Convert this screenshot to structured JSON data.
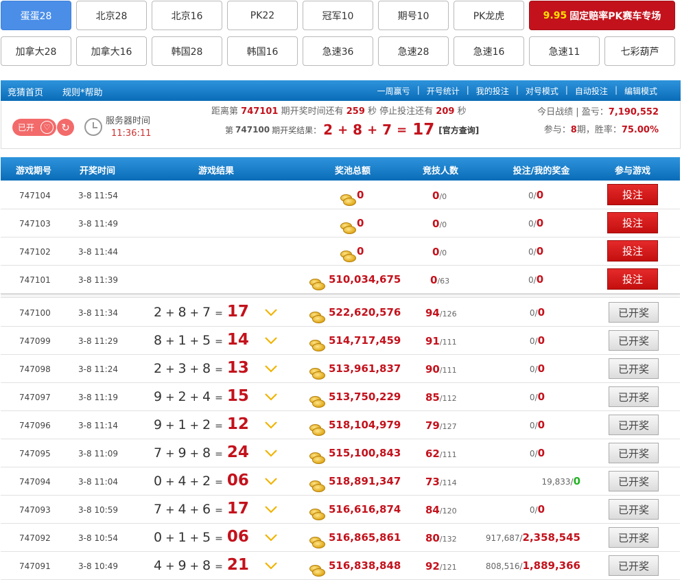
{
  "tabs_row1": [
    "蛋蛋28",
    "北京28",
    "北京16",
    "PK22",
    "冠军10",
    "期号10",
    "PK龙虎"
  ],
  "promo": {
    "highlight": "9.95",
    "label": "固定赔率PK赛车专场"
  },
  "tabs_row2": [
    "加拿大28",
    "加拿大16",
    "韩国28",
    "韩国16",
    "急速36",
    "急速28",
    "急速16",
    "急速11",
    "七彩葫芦"
  ],
  "nav": {
    "home": "竞猜首页",
    "rules": "规则*帮助",
    "links": [
      "一周赢亏",
      "开号统计",
      "我的投注",
      "对号模式",
      "自动投注",
      "编辑模式"
    ],
    "separator": "|"
  },
  "info": {
    "status": "已开",
    "server_time_label": "服务器时间",
    "server_time": "11:36:11",
    "countdown_prefix": "距离第",
    "countdown_period": "747101",
    "countdown_mid": "期开奖时间还有",
    "countdown_seconds": "259",
    "countdown_sec_unit": "秒 停止投注还有",
    "stop_seconds": "209",
    "stop_unit": "秒",
    "last_prefix": "第",
    "last_period": "747100",
    "last_mid": "期开奖结果：",
    "last_a": "2",
    "last_b": "8",
    "last_c": "7",
    "last_sum": "17",
    "official": "[官方查询]",
    "today_label": "今日战绩 | 盈亏：",
    "today_value": "7,190,552",
    "join_label": "参与：",
    "join_value": "8",
    "join_unit": "期，胜率：",
    "win_rate": "75.00%"
  },
  "table_headers": [
    "游戏期号",
    "开奖时间",
    "游戏结果",
    "奖池总额",
    "竞技人数",
    "投注/我的奖金",
    "参与游戏"
  ],
  "colors": {
    "accent": "#0a6cb8",
    "red": "#c3121c",
    "green": "#23b223"
  },
  "open_rows": [
    {
      "period": "747104",
      "time": "3-8 11:54",
      "pool": "0",
      "players": "0",
      "total": "/0",
      "bet": "0/",
      "win": "0",
      "action": "投注"
    },
    {
      "period": "747103",
      "time": "3-8 11:49",
      "pool": "0",
      "players": "0",
      "total": "/0",
      "bet": "0/",
      "win": "0",
      "action": "投注"
    },
    {
      "period": "747102",
      "time": "3-8 11:44",
      "pool": "0",
      "players": "0",
      "total": "/0",
      "bet": "0/",
      "win": "0",
      "action": "投注"
    },
    {
      "period": "747101",
      "time": "3-8 11:39",
      "pool": "510,034,675",
      "players": "0",
      "total": "/63",
      "bet": "0/",
      "win": "0",
      "action": "投注"
    }
  ],
  "closed_rows": [
    {
      "period": "747100",
      "time": "3-8 11:34",
      "a": "2",
      "b": "8",
      "c": "7",
      "sum": "17",
      "pool": "522,620,576",
      "players": "94",
      "total": "/126",
      "bet": "0/",
      "win": "0",
      "win_green": false,
      "action": "已开奖"
    },
    {
      "period": "747099",
      "time": "3-8 11:29",
      "a": "8",
      "b": "1",
      "c": "5",
      "sum": "14",
      "pool": "514,717,459",
      "players": "91",
      "total": "/111",
      "bet": "0/",
      "win": "0",
      "win_green": false,
      "action": "已开奖"
    },
    {
      "period": "747098",
      "time": "3-8 11:24",
      "a": "2",
      "b": "3",
      "c": "8",
      "sum": "13",
      "pool": "513,961,837",
      "players": "90",
      "total": "/111",
      "bet": "0/",
      "win": "0",
      "win_green": false,
      "action": "已开奖"
    },
    {
      "period": "747097",
      "time": "3-8 11:19",
      "a": "9",
      "b": "2",
      "c": "4",
      "sum": "15",
      "pool": "513,750,229",
      "players": "85",
      "total": "/112",
      "bet": "0/",
      "win": "0",
      "win_green": false,
      "action": "已开奖"
    },
    {
      "period": "747096",
      "time": "3-8 11:14",
      "a": "9",
      "b": "1",
      "c": "2",
      "sum": "12",
      "pool": "518,104,979",
      "players": "79",
      "total": "/127",
      "bet": "0/",
      "win": "0",
      "win_green": false,
      "action": "已开奖"
    },
    {
      "period": "747095",
      "time": "3-8 11:09",
      "a": "7",
      "b": "9",
      "c": "8",
      "sum": "24",
      "pool": "515,100,843",
      "players": "62",
      "total": "/111",
      "bet": "0/",
      "win": "0",
      "win_green": false,
      "action": "已开奖"
    },
    {
      "period": "747094",
      "time": "3-8 11:04",
      "a": "0",
      "b": "4",
      "c": "2",
      "sum": "06",
      "pool": "518,891,347",
      "players": "73",
      "total": "/114",
      "bet": "19,833/",
      "win": "0",
      "win_green": true,
      "action": "已开奖"
    },
    {
      "period": "747093",
      "time": "3-8 10:59",
      "a": "7",
      "b": "4",
      "c": "6",
      "sum": "17",
      "pool": "516,616,874",
      "players": "84",
      "total": "/120",
      "bet": "0/",
      "win": "0",
      "win_green": false,
      "action": "已开奖"
    },
    {
      "period": "747092",
      "time": "3-8 10:54",
      "a": "0",
      "b": "1",
      "c": "5",
      "sum": "06",
      "pool": "516,865,861",
      "players": "80",
      "total": "/132",
      "bet": "917,687/",
      "win": "2,358,545",
      "win_green": false,
      "action": "已开奖"
    },
    {
      "period": "747091",
      "time": "3-8 10:49",
      "a": "4",
      "b": "9",
      "c": "8",
      "sum": "21",
      "pool": "516,838,848",
      "players": "92",
      "total": "/121",
      "bet": "808,516/",
      "win": "1,889,366",
      "win_green": false,
      "action": "已开奖"
    }
  ]
}
